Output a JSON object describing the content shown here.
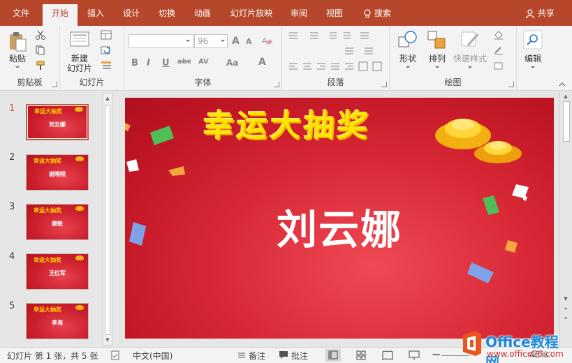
{
  "tabs": [
    {
      "label": "文件"
    },
    {
      "label": "开始"
    },
    {
      "label": "插入"
    },
    {
      "label": "设计"
    },
    {
      "label": "切换"
    },
    {
      "label": "动画"
    },
    {
      "label": "幻灯片放映"
    },
    {
      "label": "审阅"
    },
    {
      "label": "视图"
    },
    {
      "label": "搜索"
    }
  ],
  "share_label": "共享",
  "ribbon": {
    "clipboard": {
      "paste_label": "粘贴",
      "group_label": "剪贴板"
    },
    "slides": {
      "new_slide_label_1": "新建",
      "new_slide_label_2": "幻灯片",
      "group_label": "幻灯片"
    },
    "font": {
      "font_name": "",
      "font_size": "96",
      "group_label": "字体",
      "bold": "B",
      "italic": "I",
      "underline": "U",
      "strike": "abc",
      "spacing": "AV",
      "case": "Aa",
      "color": "A",
      "grow": "A",
      "shrink": "A"
    },
    "paragraph": {
      "group_label": "段落"
    },
    "drawing": {
      "shape_label": "形状",
      "arrange_label": "排列",
      "quickstyle_label": "快速样式",
      "group_label": "绘图"
    },
    "edit": {
      "edit_label": "编辑"
    }
  },
  "slides": [
    {
      "num": "1",
      "title": "幸运大抽奖",
      "name": "刘云娜"
    },
    {
      "num": "2",
      "title": "幸运大抽奖",
      "name": "谢晓晓"
    },
    {
      "num": "3",
      "title": "幸运大抽奖",
      "name": "唐敏"
    },
    {
      "num": "4",
      "title": "幸运大抽奖",
      "name": "王红军"
    },
    {
      "num": "5",
      "title": "幸运大抽奖",
      "name": "李海"
    }
  ],
  "main_slide": {
    "title": "幸运大抽奖",
    "name": "刘云娜"
  },
  "status": {
    "slide_info": "幻灯片 第 1 张，共 5 张",
    "language": "中文(中国)",
    "notes": "备注",
    "comments": "批注",
    "zoom": "48%"
  },
  "watermark": {
    "text": "Office教程网",
    "url": "www.office26.com"
  },
  "colors": {
    "accent": "#b7472a",
    "slide_red": "#d82836",
    "title_yellow": "#ffe600"
  }
}
